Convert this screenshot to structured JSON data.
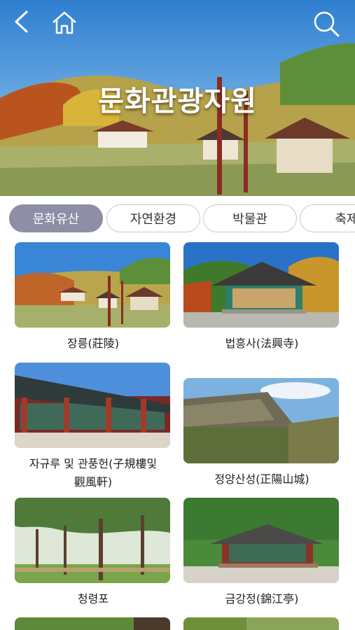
{
  "hero": {
    "title": "문화관광자원",
    "back_icon": "chevron-left-icon",
    "home_icon": "home-icon",
    "search_icon": "search-icon"
  },
  "tabs": [
    {
      "label": "문화유산",
      "active": true
    },
    {
      "label": "자연환경",
      "active": false
    },
    {
      "label": "박물관",
      "active": false
    },
    {
      "label": "축제",
      "active": false
    }
  ],
  "items": [
    {
      "name": "장릉(莊陵)"
    },
    {
      "name": "법흥사(法興寺)"
    },
    {
      "name": "자규루 및 관풍헌(子規樓및",
      "name_line2": "觀風軒)"
    },
    {
      "name": "정양산성(正陽山城)"
    },
    {
      "name": "청령포"
    },
    {
      "name": "금강정(錦江亭)"
    }
  ],
  "colors": {
    "active_tab_bg": "#8e8fa6",
    "tab_border": "#c9c9c9"
  }
}
